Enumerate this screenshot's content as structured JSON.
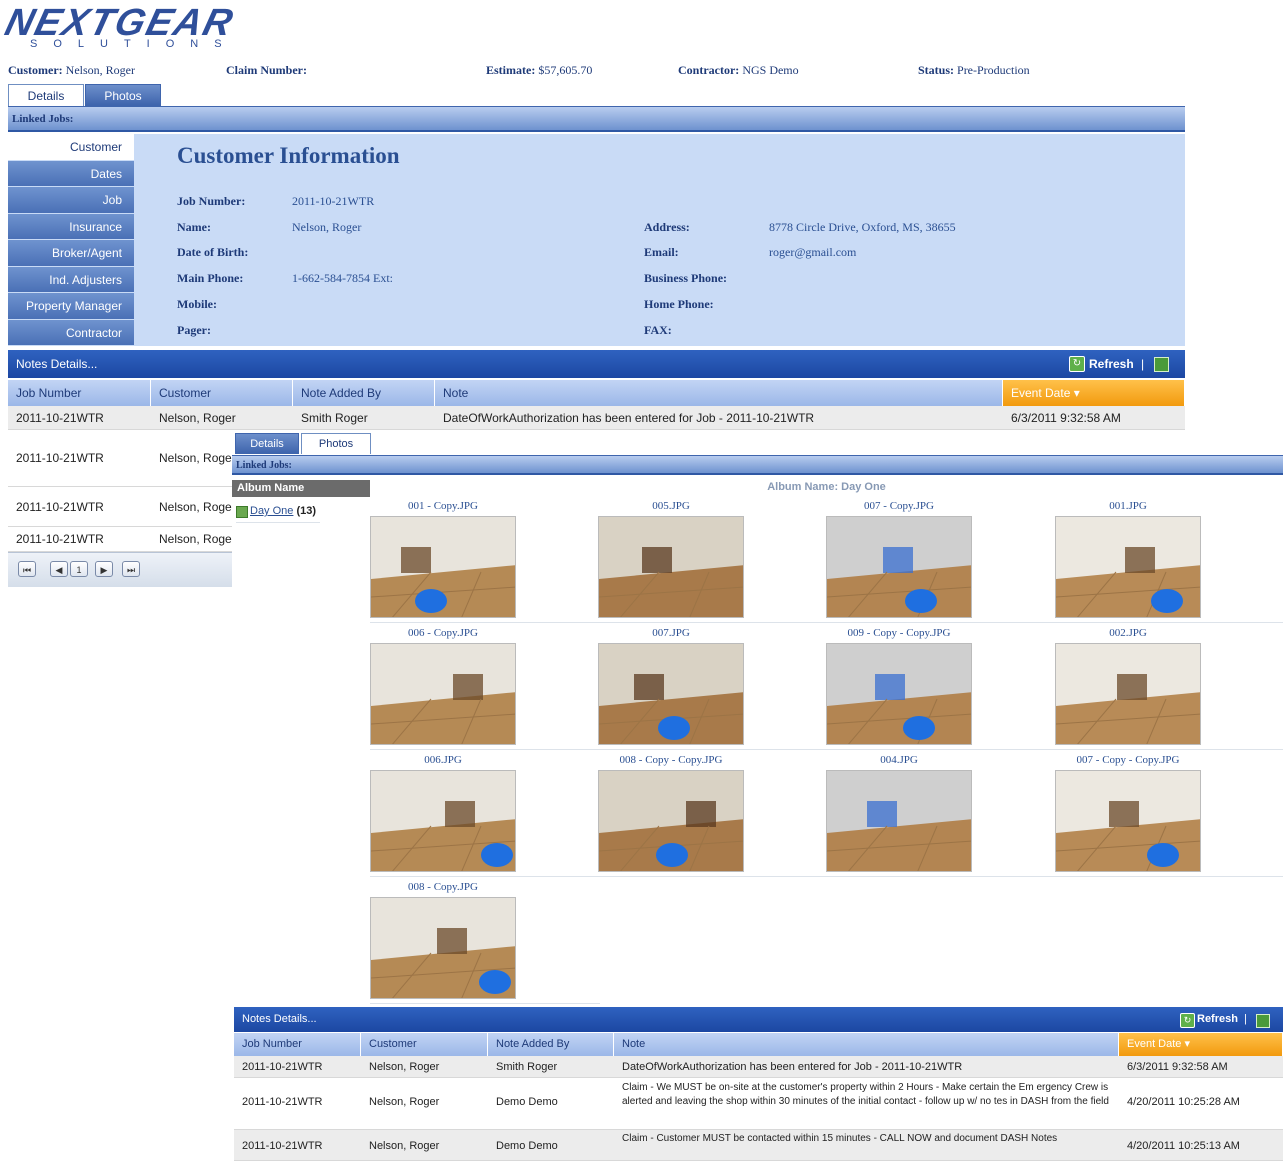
{
  "brand": {
    "logo_main": "NEXTGEAR",
    "logo_sub": "SOLUTIONS",
    "color": "#2f4f9a"
  },
  "header": {
    "customer_label": "Customer:",
    "customer_value": "Nelson, Roger",
    "claim_label": "Claim Number:",
    "claim_value": "",
    "estimate_label": "Estimate:",
    "estimate_value": "$57,605.70",
    "contractor_label": "Contractor:",
    "contractor_value": "NGS Demo",
    "status_label": "Status:",
    "status_value": "Pre-Production"
  },
  "tabs": [
    {
      "label": "Details"
    },
    {
      "label": "Photos"
    }
  ],
  "linked_jobs_label": "Linked Jobs:",
  "sidenav": [
    {
      "label": "Customer"
    },
    {
      "label": "Dates"
    },
    {
      "label": "Job"
    },
    {
      "label": "Insurance"
    },
    {
      "label": "Broker/Agent"
    },
    {
      "label": "Ind. Adjusters"
    },
    {
      "label": "Property Manager"
    },
    {
      "label": "Contractor"
    }
  ],
  "customer_info": {
    "title": "Customer Information",
    "job_number_label": "Job Number:",
    "job_number": "2011-10-21WTR",
    "name_label": "Name:",
    "name": "Nelson, Roger",
    "dob_label": "Date of Birth:",
    "dob": "",
    "main_phone_label": "Main Phone:",
    "main_phone": "1-662-584-7854 Ext:",
    "mobile_label": "Mobile:",
    "mobile": "",
    "pager_label": "Pager:",
    "pager": "",
    "address_label": "Address:",
    "address": "8778 Circle Drive, Oxford, MS, 38655",
    "email_label": "Email:",
    "email": "roger@gmail.com",
    "business_phone_label": "Business Phone:",
    "business_phone": "",
    "home_phone_label": "Home Phone:",
    "home_phone": "",
    "fax_label": "FAX:",
    "fax": ""
  },
  "notes": {
    "title": "Notes Details...",
    "refresh_label": "Refresh",
    "separator": "|",
    "columns": [
      "Job Number",
      "Customer",
      "Note Added By",
      "Note",
      "Event Date"
    ],
    "rows_back": [
      {
        "job": "2011-10-21WTR",
        "customer": "Nelson, Roger",
        "by": "Smith Roger",
        "note": "DateOfWorkAuthorization has been entered for Job - 2011-10-21WTR",
        "date": "6/3/2011 9:32:58 AM"
      },
      {
        "job": "2011-10-21WTR",
        "customer": "Nelson, Roge"
      },
      {
        "job": "2011-10-21WTR",
        "customer": "Nelson, Roge"
      },
      {
        "job": "2011-10-21WTR",
        "customer": "Nelson, Roge"
      }
    ],
    "pager": {
      "first": "⏮",
      "prev": "◀",
      "page": "1",
      "next": "▶",
      "last": "⏭"
    },
    "rows_front": [
      {
        "job": "2011-10-21WTR",
        "customer": "Nelson, Roger",
        "by": "Smith Roger",
        "note": "DateOfWorkAuthorization has been entered for Job - 2011-10-21WTR",
        "date": "6/3/2011 9:32:58 AM"
      },
      {
        "job": "2011-10-21WTR",
        "customer": "Nelson, Roger",
        "by": "Demo Demo",
        "note": "Claim - We MUST be on-site at the customer's property within 2 Hours - Make certain the Em ergency Crew is alerted and leaving the shop within 30 minutes of the initial contact - follow up w/ no tes in DASH from the field",
        "date": "4/20/2011 10:25:28 AM"
      },
      {
        "job": "2011-10-21WTR",
        "customer": "Nelson, Roger",
        "by": "Demo Demo",
        "note": "Claim - Customer MUST be contacted within 15 minutes - CALL NOW and document DASH Notes",
        "date": "4/20/2011 10:25:13 AM"
      }
    ]
  },
  "photos": {
    "album_header": "Album Name",
    "album_link": "Day One",
    "album_count": "(13)",
    "album_name_label": "Album Name: Day One",
    "items": [
      {
        "caption": "001 - Copy.JPG"
      },
      {
        "caption": "005.JPG"
      },
      {
        "caption": "007 - Copy.JPG"
      },
      {
        "caption": "001.JPG"
      },
      {
        "caption": "006 - Copy.JPG"
      },
      {
        "caption": "007.JPG"
      },
      {
        "caption": "009 - Copy - Copy.JPG"
      },
      {
        "caption": "002.JPG"
      },
      {
        "caption": "006.JPG"
      },
      {
        "caption": "008 - Copy - Copy.JPG"
      },
      {
        "caption": "004.JPG"
      },
      {
        "caption": "007 - Copy - Copy.JPG"
      },
      {
        "caption": "008 - Copy.JPG"
      }
    ]
  },
  "colors": {
    "accent": "#2f58a4",
    "panel": "#c9dbf6",
    "sort": "#f29a0e"
  }
}
